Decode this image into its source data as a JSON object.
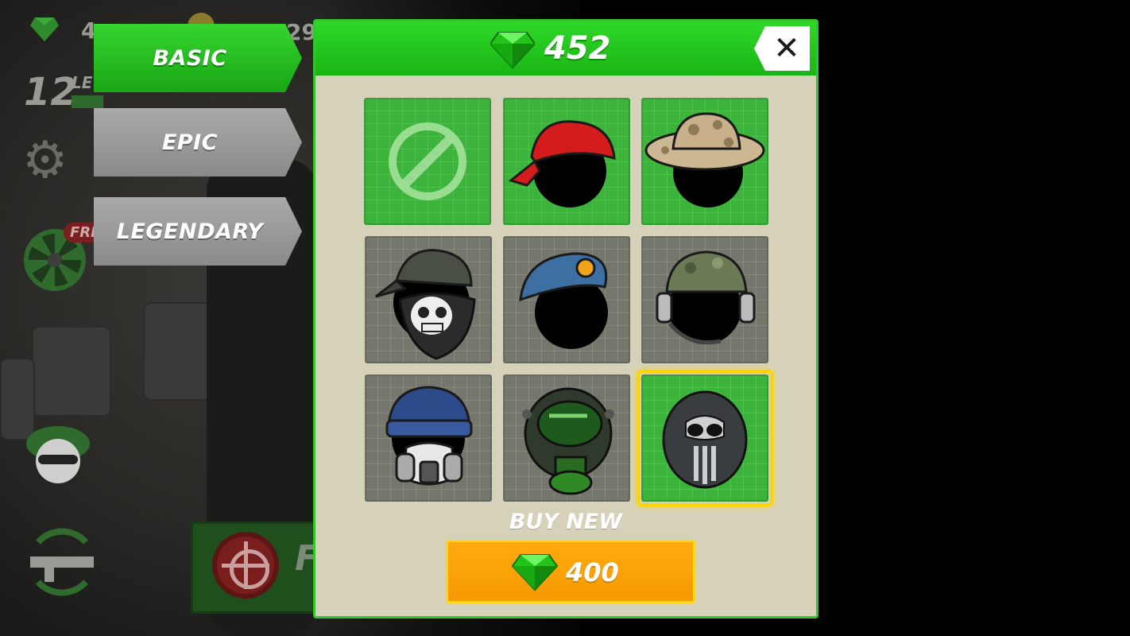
{
  "hud": {
    "gem_count_partial": "4",
    "coin_count_partial": "29",
    "level_number": "12",
    "level_label_partial": "LE",
    "free_badge_partial": "FRE",
    "fire_label_partial": "F"
  },
  "tabs": [
    {
      "label": "BASIC",
      "active": true
    },
    {
      "label": "EPIC",
      "active": false
    },
    {
      "label": "LEGENDARY",
      "active": false
    }
  ],
  "store": {
    "gem_balance": "452",
    "close_icon": "close-icon",
    "items": [
      {
        "name": "none",
        "icon": "no-hat-icon",
        "owned": true
      },
      {
        "name": "red bandana",
        "icon": "red-bandana-icon",
        "owned": true
      },
      {
        "name": "camo boonie hat",
        "icon": "boonie-hat-icon",
        "owned": true
      },
      {
        "name": "cap with skull mask",
        "icon": "skull-mask-cap-icon",
        "owned": false
      },
      {
        "name": "blue beret",
        "icon": "blue-beret-icon",
        "owned": false
      },
      {
        "name": "camo cap with headset",
        "icon": "headset-cap-icon",
        "owned": false
      },
      {
        "name": "beanie with respirator",
        "icon": "respirator-beanie-icon",
        "owned": false
      },
      {
        "name": "gas mask",
        "icon": "gas-mask-icon",
        "owned": false
      },
      {
        "name": "skull helmet",
        "icon": "skull-helmet-icon",
        "owned": true,
        "selected": true
      }
    ],
    "buy_label": "BUY NEW",
    "buy_price": "400"
  },
  "colors": {
    "accent_green": "#1ab515",
    "panel_bg": "#d6d2ba",
    "buy_orange": "#f59a00",
    "selected_yellow": "#ffd400"
  }
}
